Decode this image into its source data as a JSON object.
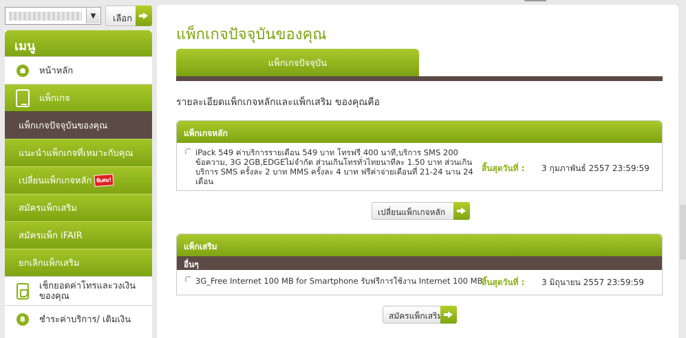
{
  "top": {
    "select_value": "",
    "go_label": "เลือก"
  },
  "menu": {
    "title": "เมนู",
    "items": [
      {
        "label": "หน้าหลัก",
        "icon": "home-icon"
      },
      {
        "label": "แพ็กเกจ",
        "icon": "phone-icon"
      },
      {
        "label": "แพ็กเกจปัจจุบันของคุณ"
      },
      {
        "label": "แนะนำแพ็กเกจที่เหมาะกับคุณ"
      },
      {
        "label": "เปลี่ยนแพ็กเกจหลัก",
        "badge": "พิเศษ!"
      },
      {
        "label": "สมัครแพ็กเสริม"
      },
      {
        "label": "สมัครแพ็ก iFAIR"
      },
      {
        "label": "ยกเลิกแพ็กเสริม"
      },
      {
        "label": "เช็กยอดค่าโทรและวงเงินของคุณ",
        "icon": "phone-bill-icon"
      },
      {
        "label": "ชำระค่าบริการ/ เติมเงิน",
        "icon": "baht-icon"
      }
    ]
  },
  "main": {
    "page_title": "แพ็กเกจปัจจุบันของคุณ",
    "tab_label": "แพ็กเกจปัจจุบัน",
    "description": "รายละเอียดแพ็กเกจหลักและแพ็กเสริม ของคุณคือ",
    "main_package": {
      "header": "แพ็กเกจหลัก",
      "text_line1": "iPack 549 ค่าบริการรายเดือน 549 บาท โทรฟรี 400 นาที,บริการ SMS 200",
      "text_line2": "ข้อความ, 3G 2GB,EDGEไม่จำกัด ส่วนเกินโทรทั่วไทยนาทีละ 1.50 บาท ส่วนเกิน",
      "text_line3": "บริการ SMS ครั้งละ 2 บาท MMS ครั้งละ 4 บาท ฟรีค่าจ่ายเดือนที่ 21-24 นาน 24",
      "text_line4": "เดือน",
      "expire_label": "สิ้นสุดวันที่ :",
      "expire_value": "3 กุมภาพันธ์ 2557 23:59:59",
      "button_label": "เปลี่ยนแพ็กเกจหลัก"
    },
    "addon_package": {
      "header": "แพ็กเสริม",
      "sub_header": "อื่นๆ",
      "text": "3G_Free Internet 100 MB for Smartphone รับฟรีการใช้งาน Internet 100 MB",
      "expire_label": "สิ้นสุดวันที่ :",
      "expire_value": "3 มิถุนายน 2557 23:59:59",
      "button_label": "สมัครแพ็กเสริม"
    }
  },
  "colors": {
    "accent_green": "#7ea412",
    "dark_brown": "#5c4b45"
  }
}
